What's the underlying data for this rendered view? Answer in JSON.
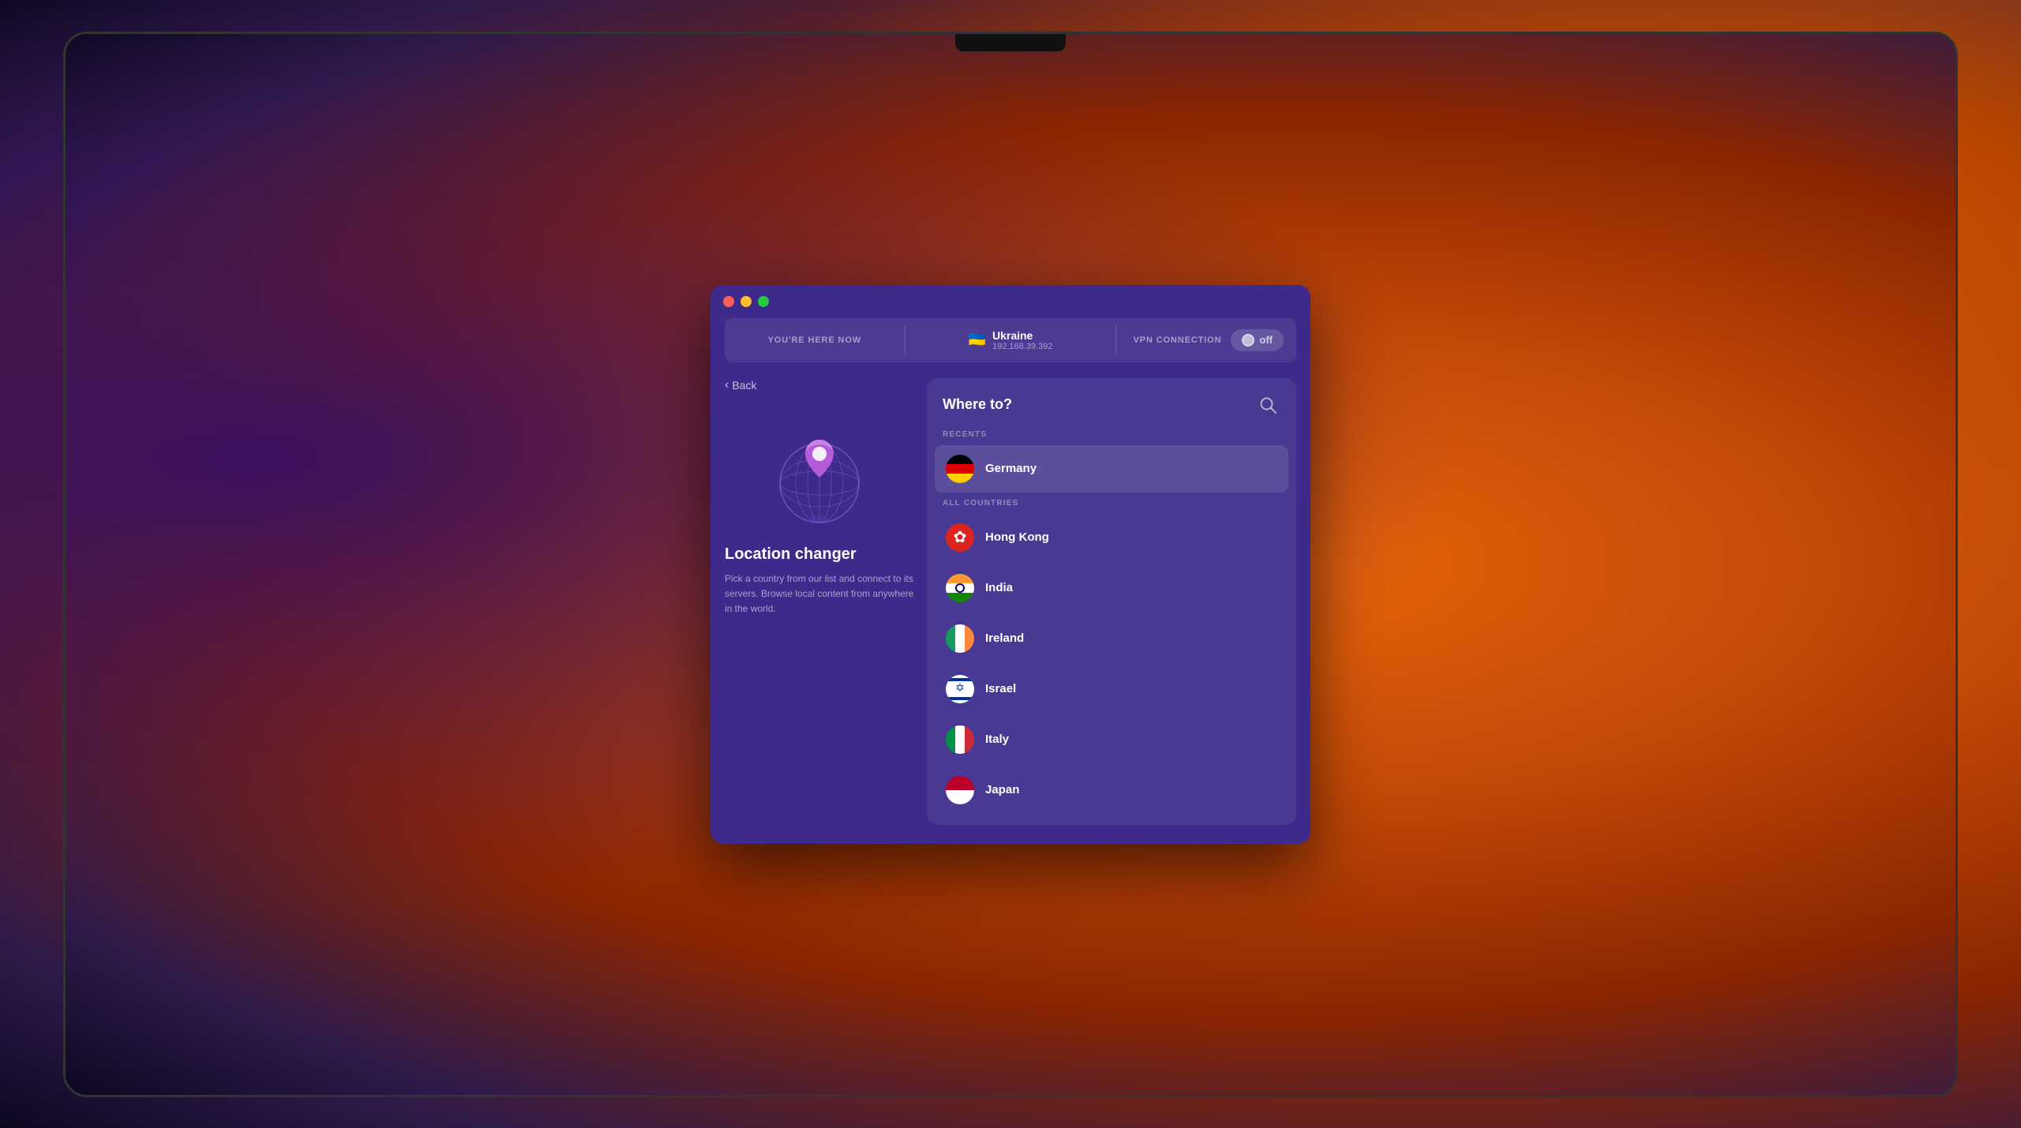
{
  "desktop": {
    "bg_color": "#1a0a2e"
  },
  "window": {
    "title_bar": {
      "close_label": "",
      "minimize_label": "",
      "maximize_label": ""
    },
    "status_bar": {
      "you_are_here_label": "YOU'RE HERE NOW",
      "country": "Ukraine",
      "ip": "192.168.39.392",
      "vpn_label": "VPN CONNECTION",
      "toggle_label": "off"
    },
    "left_panel": {
      "back_label": "Back",
      "title": "Location changer",
      "description": "Pick a country from our list and connect to its servers. Browse local content from anywhere in the world."
    },
    "right_panel": {
      "title": "Where to?",
      "search_icon": "search-icon",
      "recents_label": "RECENTS",
      "all_countries_label": "ALL COUNTRIES",
      "recents": [
        {
          "name": "Germany",
          "flag": "germany"
        }
      ],
      "countries": [
        {
          "name": "Hong Kong",
          "flag": "hk"
        },
        {
          "name": "India",
          "flag": "india"
        },
        {
          "name": "Ireland",
          "flag": "ireland"
        },
        {
          "name": "Israel",
          "flag": "israel"
        },
        {
          "name": "Italy",
          "flag": "italy"
        },
        {
          "name": "Japan",
          "flag": "japan"
        }
      ]
    }
  }
}
